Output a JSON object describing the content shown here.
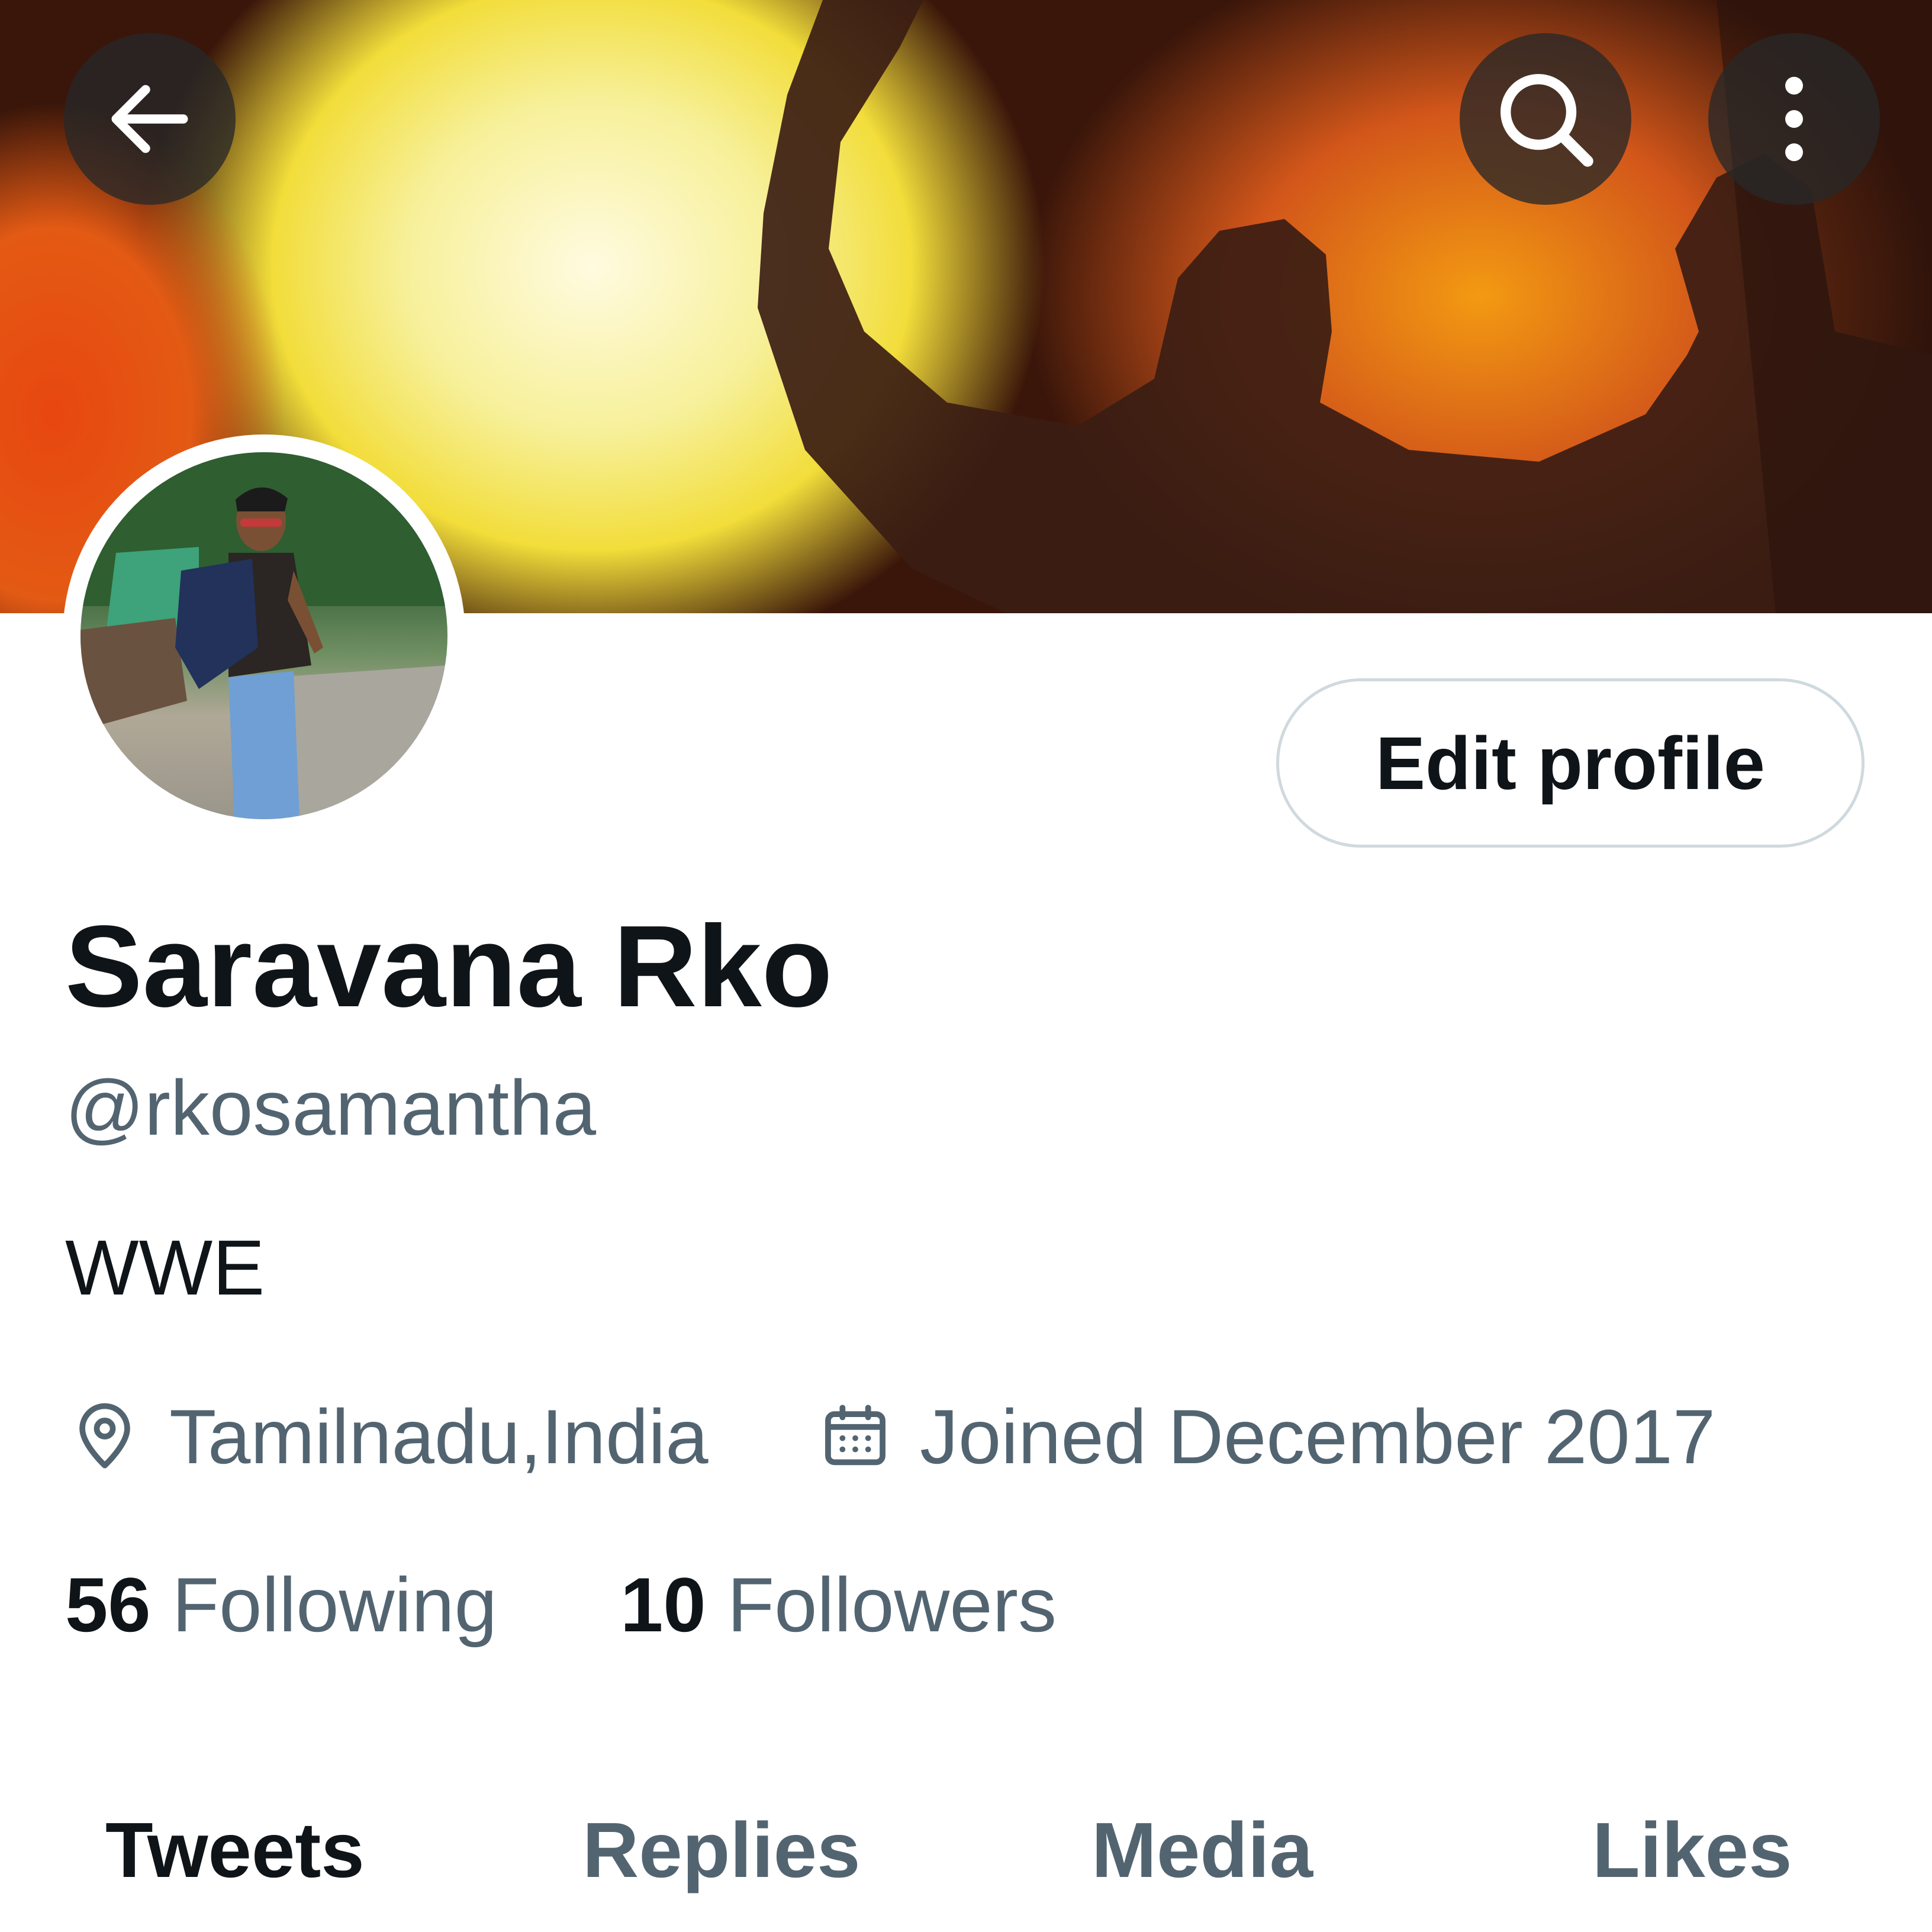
{
  "header": {
    "back_icon": "arrow-left-icon",
    "search_icon": "search-icon",
    "more_icon": "more-vertical-icon"
  },
  "profile": {
    "display_name": "Saravana Rko",
    "handle": "@rkosamantha",
    "bio": "WWE",
    "location": "Tamilnadu,India",
    "location_icon": "location-pin-icon",
    "joined": "Joined December 2017",
    "joined_icon": "calendar-icon",
    "edit_button_label": "Edit profile"
  },
  "stats": {
    "following_count": "56",
    "following_label": "Following",
    "followers_count": "10",
    "followers_label": "Followers"
  },
  "tabs": [
    {
      "label": "Tweets",
      "selected": true
    },
    {
      "label": "Replies",
      "selected": false
    },
    {
      "label": "Media",
      "selected": false
    },
    {
      "label": "Likes",
      "selected": false
    }
  ],
  "colors": {
    "primary_text": "#0f1419",
    "secondary_text": "#536471",
    "border": "#cfd9de",
    "overlay_button": "#282828"
  }
}
